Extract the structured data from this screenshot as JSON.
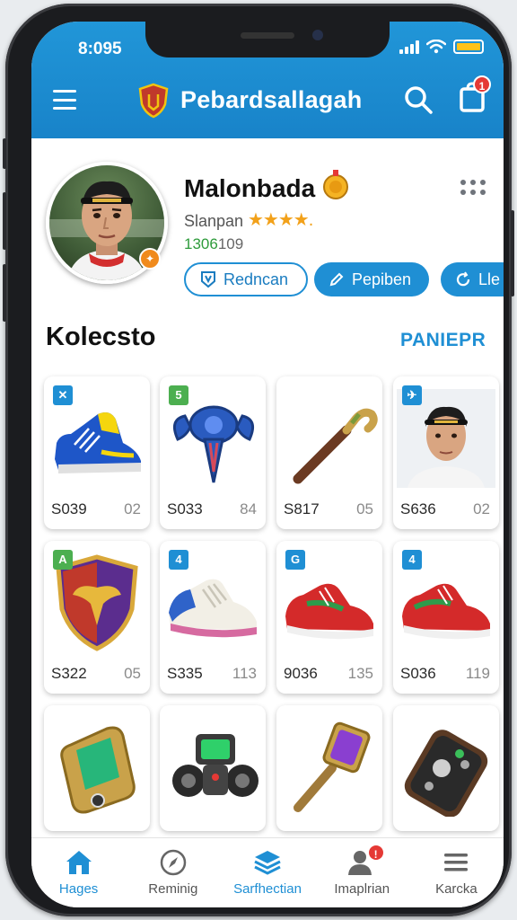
{
  "status_bar": {
    "time": "8:095"
  },
  "header": {
    "title": "Pebardsallagah",
    "icons": {
      "menu": "hamburger-icon",
      "logo": "shield-logo",
      "search": "search-icon",
      "bag": "shopping-bag-icon"
    },
    "bag_badge": "1",
    "color": "#1f8fd4"
  },
  "profile": {
    "name": "Malonbada",
    "rank": "Slanpan",
    "stars": "★★★★",
    "stars_suffix": ".",
    "points": "1306",
    "points_suffix": "109",
    "buttons": [
      {
        "label": "Redncan",
        "icon": "badge-icon"
      },
      {
        "label": "Pepiben",
        "icon": "pencil-icon"
      },
      {
        "label": "Lle",
        "icon": "refresh-icon"
      }
    ]
  },
  "collection": {
    "title": "Kolecsto",
    "link": "PANIEPR",
    "items": [
      {
        "code": "S039",
        "count": "02",
        "tag": "✕",
        "tag_color": "#1f8fd4",
        "art": "sneaker-blue-yellow"
      },
      {
        "code": "S033",
        "count": "84",
        "tag": "5",
        "tag_color": "#4caf50",
        "art": "blue-emblem"
      },
      {
        "code": "S817",
        "count": "05",
        "tag": "",
        "tag_color": "",
        "art": "golden-cane"
      },
      {
        "code": "S636",
        "count": "02",
        "tag": "✈",
        "tag_color": "#1f8fd4",
        "art": "player-portrait"
      },
      {
        "code": "S322",
        "count": "05",
        "tag": "A",
        "tag_color": "#4caf50",
        "art": "winged-shield"
      },
      {
        "code": "S335",
        "count": "113",
        "tag": "4",
        "tag_color": "#1f8fd4",
        "art": "sneaker-white-blue"
      },
      {
        "code": "9036",
        "count": "135",
        "tag": "G",
        "tag_color": "#1f8fd4",
        "art": "sneaker-red"
      },
      {
        "code": "S036",
        "count": "119",
        "tag": "4",
        "tag_color": "#1f8fd4",
        "art": "sneaker-red-2"
      },
      {
        "code": "",
        "count": "",
        "tag": "",
        "tag_color": "",
        "art": "gold-device"
      },
      {
        "code": "",
        "count": "",
        "tag": "",
        "tag_color": "",
        "art": "robot-gadget"
      },
      {
        "code": "",
        "count": "",
        "tag": "",
        "tag_color": "",
        "art": "purple-gem-key"
      },
      {
        "code": "",
        "count": "",
        "tag": "",
        "tag_color": "",
        "art": "bronze-controller"
      }
    ]
  },
  "bottom_nav": {
    "items": [
      {
        "label": "Hages",
        "icon": "home-icon",
        "active": true
      },
      {
        "label": "Reminig",
        "icon": "compass-icon",
        "active": false
      },
      {
        "label": "Sarfhectian",
        "icon": "layers-icon",
        "active": true
      },
      {
        "label": "Imaplrian",
        "icon": "user-icon",
        "active": false,
        "badge": "!"
      },
      {
        "label": "Karcka",
        "icon": "menu-icon",
        "active": false
      }
    ]
  }
}
